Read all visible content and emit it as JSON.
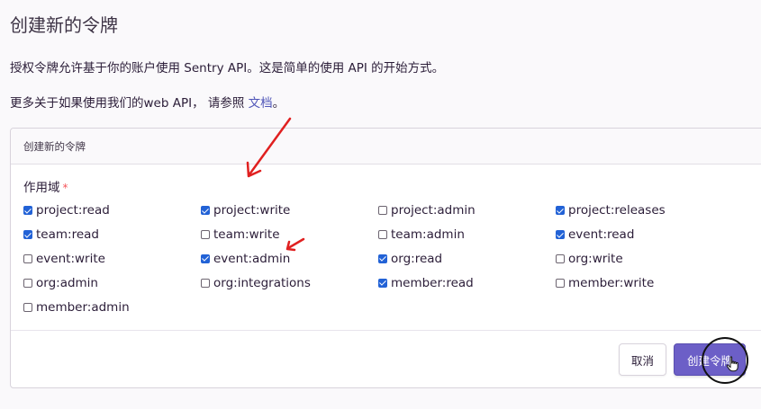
{
  "page": {
    "title": "创建新的令牌",
    "description": "授权令牌允许基于你的账户使用 Sentry API。这是简单的使用 API 的开始方式。",
    "more_prefix": "更多关于如果使用我们的web API， 请参照 ",
    "docs_link": "文档",
    "more_suffix": "。"
  },
  "panel": {
    "header": "创建新的令牌",
    "scopes_label": "作用域",
    "required_mark": "*",
    "scopes": [
      {
        "name": "project:read",
        "checked": true
      },
      {
        "name": "project:write",
        "checked": true
      },
      {
        "name": "project:admin",
        "checked": false
      },
      {
        "name": "project:releases",
        "checked": true
      },
      {
        "name": "team:read",
        "checked": true
      },
      {
        "name": "team:write",
        "checked": false
      },
      {
        "name": "team:admin",
        "checked": false
      },
      {
        "name": "event:read",
        "checked": true
      },
      {
        "name": "event:write",
        "checked": false
      },
      {
        "name": "event:admin",
        "checked": true
      },
      {
        "name": "org:read",
        "checked": true
      },
      {
        "name": "org:write",
        "checked": false
      },
      {
        "name": "org:admin",
        "checked": false
      },
      {
        "name": "org:integrations",
        "checked": false
      },
      {
        "name": "member:read",
        "checked": true
      },
      {
        "name": "member:write",
        "checked": false
      },
      {
        "name": "member:admin",
        "checked": false
      }
    ],
    "cancel_label": "取消",
    "create_label": "创建令牌"
  },
  "colors": {
    "accent": "#6c5fc7",
    "checkbox_checked": "#2262d6",
    "annotation_arrow": "#e02020",
    "link": "#4f55b8"
  }
}
